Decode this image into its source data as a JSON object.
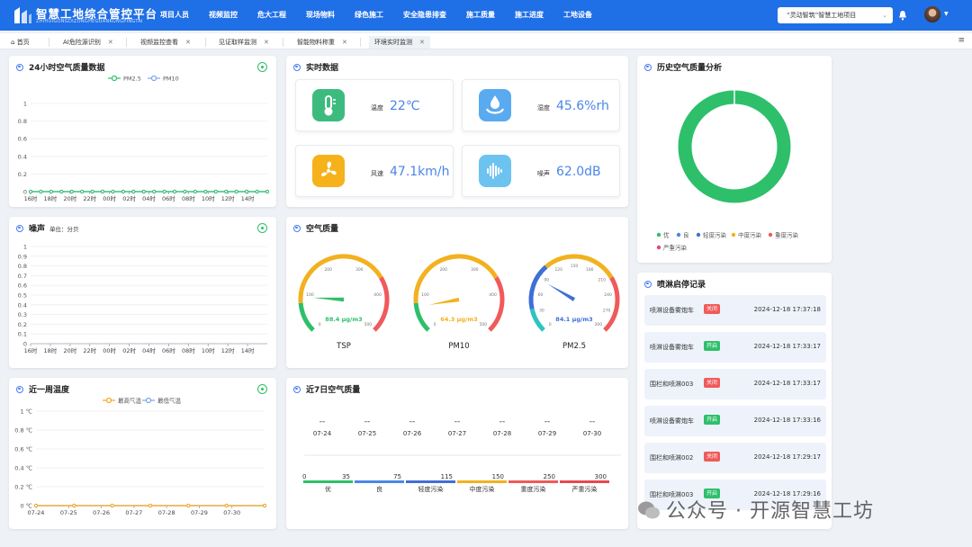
{
  "header": {
    "title": "智慧工地综合管控平台",
    "subtitle": "ZHIHUIGONGDIZONGHEGUANKONGPINGTAI",
    "nav": [
      "项目人员",
      "视频监控",
      "危大工程",
      "现场物料",
      "绿色施工",
      "安全隐患排查",
      "施工质量",
      "施工进度",
      "工地设备"
    ],
    "project": "“灵动智筑”智慧工地项目"
  },
  "tabs": [
    "首页",
    "AI危险源识别",
    "视频监控查看",
    "见证取样监测",
    "智能物料称重",
    "环境实时监测"
  ],
  "air24": {
    "title": "24小时空气质量数据",
    "legend": [
      "PM2.5",
      "PM10"
    ],
    "colors": {
      "pm25": "#2ebf6a",
      "pm10": "#7aa6e8"
    },
    "y_ticks": [
      "1",
      "0.8",
      "0.6",
      "0.4",
      "0.2",
      "0"
    ],
    "x_ticks": [
      "16时",
      "18时",
      "20时",
      "22时",
      "00时",
      "02时",
      "04时",
      "06时",
      "08时",
      "10时",
      "12时",
      "14时"
    ]
  },
  "noise": {
    "title": "噪声",
    "unit": "单位：分贝",
    "y_ticks": [
      "1",
      "0.9",
      "0.8",
      "0.7",
      "0.6",
      "0.5",
      "0.4",
      "0.3",
      "0.2",
      "0.1",
      "0"
    ],
    "x_ticks": [
      "16时",
      "18时",
      "20时",
      "22时",
      "00时",
      "02时",
      "04时",
      "06时",
      "08时",
      "10时",
      "12时",
      "14时"
    ]
  },
  "temp": {
    "title": "近一周温度",
    "legend": [
      "最高气温",
      "最低气温"
    ],
    "colors": {
      "high": "#f5a623",
      "low": "#7aa6e8"
    },
    "y_ticks": [
      "1 ℃",
      "0.8 ℃",
      "0.6 ℃",
      "0.4 ℃",
      "0.2 ℃",
      "0 ℃"
    ],
    "x_ticks": [
      "07-24",
      "07-25",
      "07-26",
      "07-27",
      "07-28",
      "07-29",
      "07-30"
    ]
  },
  "realtime": {
    "title": "实时数据",
    "items": [
      {
        "label": "温度",
        "value": "22℃",
        "icon": "thermometer-icon",
        "color": "#3dbb7e"
      },
      {
        "label": "湿度",
        "value": "45.6%rh",
        "icon": "humidity-icon",
        "color": "#5aaaf0"
      },
      {
        "label": "风速",
        "value": "47.1km/h",
        "icon": "fan-icon",
        "color": "#f6b21a"
      },
      {
        "label": "噪声",
        "value": "62.0dB",
        "icon": "soundwave-icon",
        "color": "#6cc3f0"
      }
    ]
  },
  "aq": {
    "title": "空气质量",
    "gauges": [
      {
        "name": "TSP",
        "reading": "88.4 μg/m3",
        "color": "#2ebf6a",
        "scale": [
          "0",
          "100",
          "200",
          "300",
          "400",
          "500"
        ],
        "value_fraction": 0.18
      },
      {
        "name": "PM10",
        "reading": "64.3 μg/m3",
        "color": "#f2b11e",
        "scale": [
          "0",
          "100",
          "200",
          "300",
          "400",
          "500"
        ],
        "value_fraction": 0.13
      },
      {
        "name": "PM2.5",
        "reading": "84.1 μg/m3",
        "color": "#3f6fd8",
        "scale": [
          "0",
          "30",
          "60",
          "90",
          "120",
          "150",
          "180",
          "210",
          "240",
          "270",
          "300"
        ],
        "value_fraction": 0.28
      }
    ]
  },
  "week": {
    "title": "近7日空气质量",
    "days": [
      "07-24",
      "07-25",
      "07-26",
      "07-27",
      "07-28",
      "07-29",
      "07-30"
    ],
    "values": [
      "--",
      "--",
      "--",
      "--",
      "--",
      "--",
      "--"
    ],
    "scale_nums": [
      "0",
      "35",
      "75",
      "115",
      "150",
      "250",
      "300"
    ],
    "levels": [
      "优",
      "良",
      "轻度污染",
      "中度污染",
      "重度污染",
      "严重污染"
    ],
    "level_colors": [
      "#2ebf6a",
      "#4a86e8",
      "#3f6fd8",
      "#f2b11e",
      "#f05a5a",
      "#e8484f"
    ]
  },
  "history": {
    "title": "历史空气质量分析",
    "legend": [
      "优",
      "良",
      "轻度污染",
      "中度污染",
      "重度污染",
      "严重污染"
    ],
    "legend_colors": [
      "#2ebf6a",
      "#4a86e8",
      "#3f6fd8",
      "#f2b11e",
      "#f05a5a",
      "#e0487a"
    ]
  },
  "spray": {
    "title": "喷淋启停记录",
    "records": [
      {
        "name": "喷淋设备雾炮车",
        "status": "关闭",
        "time": "2024-12-18 17:37:18"
      },
      {
        "name": "喷淋设备雾炮车",
        "status": "开启",
        "time": "2024-12-18 17:33:17"
      },
      {
        "name": "围栏和喷淋003",
        "status": "关闭",
        "time": "2024-12-18 17:33:17"
      },
      {
        "name": "喷淋设备雾炮车",
        "status": "开启",
        "time": "2024-12-18 17:33:16"
      },
      {
        "name": "围栏和喷淋002",
        "status": "关闭",
        "time": "2024-12-18 17:29:17"
      },
      {
        "name": "围栏和喷淋003",
        "status": "开启",
        "time": "2024-12-18 17:29:16"
      }
    ],
    "colors": {
      "on": "#2ebf6a",
      "off": "#f05a5a"
    }
  },
  "watermark": "公众号 · 开源智慧工坊"
}
